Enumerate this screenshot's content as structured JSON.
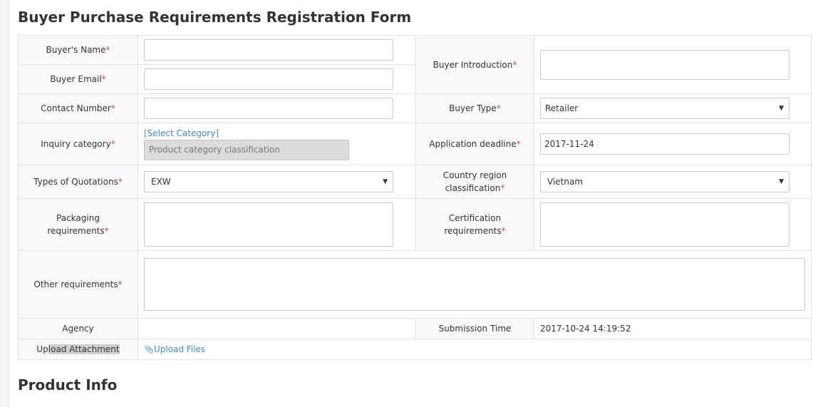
{
  "form": {
    "title": "Buyer Purchase Requirements Registration Form",
    "required_mark": "*",
    "labels": {
      "buyer_name": "Buyer's Name",
      "buyer_email": "Buyer Email",
      "buyer_introduction": "Buyer Introduction",
      "contact_number": "Contact Number",
      "buyer_type": "Buyer Type",
      "inquiry_category": "Inquiry category",
      "application_deadline": "Application deadline",
      "types_of_quotations": "Types of Quotations",
      "country_region_line1": "Country region",
      "country_region_line2": "classification",
      "packaging_requirements": "Packaging requirements",
      "certification_requirements": "Certification requirements",
      "other_requirements": "Other requirements",
      "agency": "Agency",
      "submission_time": "Submission Time",
      "upload_attachment_pre": "Up",
      "upload_attachment_sel": "load Attachment"
    },
    "values": {
      "buyer_name": "",
      "buyer_email": "",
      "contact_number": "",
      "buyer_type": "Retailer",
      "select_category_link": "[Select Category]",
      "category_placeholder": "Product category classification",
      "application_deadline": "2017-11-24",
      "types_of_quotations": "EXW",
      "country_region": "Vietnam",
      "agency": "",
      "submission_time": "2017-10-24 14:19:52",
      "upload_files_link": "Upload Files"
    },
    "icons": {
      "dropdown": "chevron-down-icon",
      "attachment": "paperclip-icon"
    }
  },
  "product_info": {
    "title": "Product Info"
  }
}
